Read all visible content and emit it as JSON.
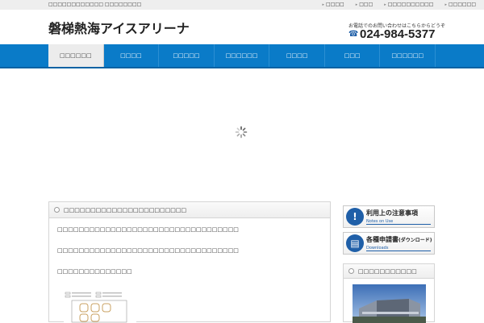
{
  "topbar": {
    "tagline": "□□□□□□□□□□□□ □□□□□□□□",
    "links": [
      "□□□□",
      "□□□",
      "□□□□□□□□□□",
      "□□□□□□"
    ]
  },
  "header": {
    "site_title": "磐梯熱海アイスアリーナ",
    "contact_note": "お電話でのお問い合わせはこちらからどうぞ",
    "phone_icon": "phone-icon",
    "phone_number": "024-984-5377"
  },
  "nav": {
    "items": [
      {
        "label": "□□□□□□",
        "active": true
      },
      {
        "label": "□□□□",
        "active": false
      },
      {
        "label": "□□□□□",
        "active": false
      },
      {
        "label": "□□□□□□",
        "active": false
      },
      {
        "label": "□□□□",
        "active": false
      },
      {
        "label": "□□□",
        "active": false
      },
      {
        "label": "□□□□□□",
        "active": false
      }
    ]
  },
  "slider": {
    "state": "loading"
  },
  "main": {
    "heading": "□□□□□□□□□□□□□□□□□□□□□□□",
    "paragraphs": [
      "□□□□□□□□□□□□□□□□□□□□□□□□□□□□□□□□□□",
      "□□□□□□□□□□□□□□□□□□□□□□□□□□□□□□□□□□",
      "□□□□□□□□□□□□□□"
    ]
  },
  "sidebar": {
    "notes_button": {
      "title": "利用上の注意事項",
      "sub": "Notes on Use",
      "icon": "warning-icon"
    },
    "downloads_button": {
      "title": "各種申請書",
      "title_small": "(ダウンロード)",
      "sub": "Downloads",
      "icon": "document-icon"
    },
    "box_heading": "□□□□□□□□□□□"
  },
  "colors": {
    "nav_blue": "#0a7bc8",
    "accent_blue": "#1f5fa8"
  }
}
